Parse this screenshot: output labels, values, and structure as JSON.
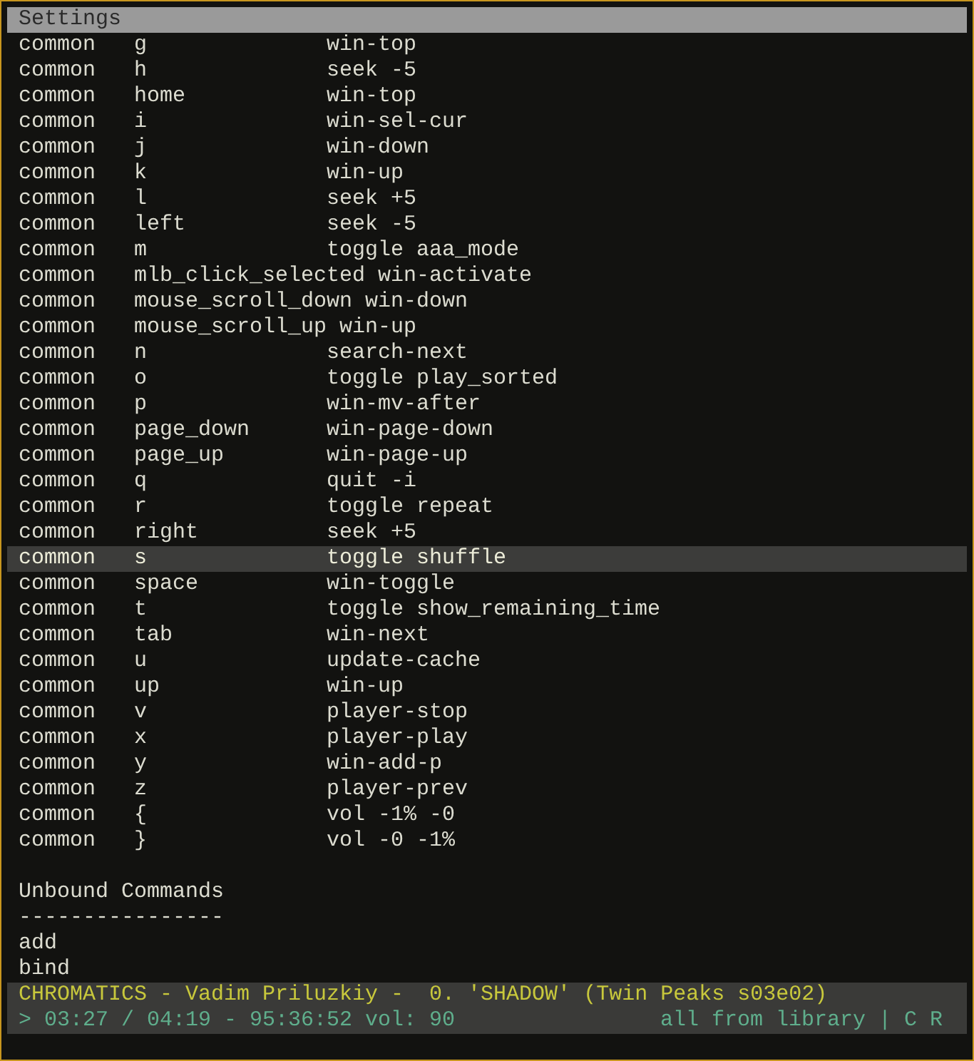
{
  "window": {
    "title": "Settings"
  },
  "bindings": [
    {
      "context": "common",
      "key": "g",
      "command": "win-top",
      "selected": false
    },
    {
      "context": "common",
      "key": "h",
      "command": "seek -5",
      "selected": false
    },
    {
      "context": "common",
      "key": "home",
      "command": "win-top",
      "selected": false
    },
    {
      "context": "common",
      "key": "i",
      "command": "win-sel-cur",
      "selected": false
    },
    {
      "context": "common",
      "key": "j",
      "command": "win-down",
      "selected": false
    },
    {
      "context": "common",
      "key": "k",
      "command": "win-up",
      "selected": false
    },
    {
      "context": "common",
      "key": "l",
      "command": "seek +5",
      "selected": false
    },
    {
      "context": "common",
      "key": "left",
      "command": "seek -5",
      "selected": false
    },
    {
      "context": "common",
      "key": "m",
      "command": "toggle aaa_mode",
      "selected": false
    },
    {
      "context": "common",
      "key": "mlb_click_selected",
      "command": "win-activate",
      "selected": false
    },
    {
      "context": "common",
      "key": "mouse_scroll_down",
      "command": "win-down",
      "selected": false
    },
    {
      "context": "common",
      "key": "mouse_scroll_up",
      "command": "win-up",
      "selected": false
    },
    {
      "context": "common",
      "key": "n",
      "command": "search-next",
      "selected": false
    },
    {
      "context": "common",
      "key": "o",
      "command": "toggle play_sorted",
      "selected": false
    },
    {
      "context": "common",
      "key": "p",
      "command": "win-mv-after",
      "selected": false
    },
    {
      "context": "common",
      "key": "page_down",
      "command": "win-page-down",
      "selected": false
    },
    {
      "context": "common",
      "key": "page_up",
      "command": "win-page-up",
      "selected": false
    },
    {
      "context": "common",
      "key": "q",
      "command": "quit -i",
      "selected": false
    },
    {
      "context": "common",
      "key": "r",
      "command": "toggle repeat",
      "selected": false
    },
    {
      "context": "common",
      "key": "right",
      "command": "seek +5",
      "selected": false
    },
    {
      "context": "common",
      "key": "s",
      "command": "toggle shuffle",
      "selected": true
    },
    {
      "context": "common",
      "key": "space",
      "command": "win-toggle",
      "selected": false
    },
    {
      "context": "common",
      "key": "t",
      "command": "toggle show_remaining_time",
      "selected": false
    },
    {
      "context": "common",
      "key": "tab",
      "command": "win-next",
      "selected": false
    },
    {
      "context": "common",
      "key": "u",
      "command": "update-cache",
      "selected": false
    },
    {
      "context": "common",
      "key": "up",
      "command": "win-up",
      "selected": false
    },
    {
      "context": "common",
      "key": "v",
      "command": "player-stop",
      "selected": false
    },
    {
      "context": "common",
      "key": "x",
      "command": "player-play",
      "selected": false
    },
    {
      "context": "common",
      "key": "y",
      "command": "win-add-p",
      "selected": false
    },
    {
      "context": "common",
      "key": "z",
      "command": "player-prev",
      "selected": false
    },
    {
      "context": "common",
      "key": "{",
      "command": "vol -1% -0",
      "selected": false
    },
    {
      "context": "common",
      "key": "}",
      "command": "vol -0 -1%",
      "selected": false
    }
  ],
  "unbound": {
    "heading": "Unbound Commands",
    "rule": "----------------",
    "commands": [
      "add",
      "bind"
    ]
  },
  "status": {
    "track": "CHROMATICS - Vadim Priluzkiy -  0. 'SHADOW' (Twin Peaks s03e02)",
    "position": "> 03:27 / 04:19 - 95:36:52 vol: 90",
    "mode": "all from library | C R"
  }
}
